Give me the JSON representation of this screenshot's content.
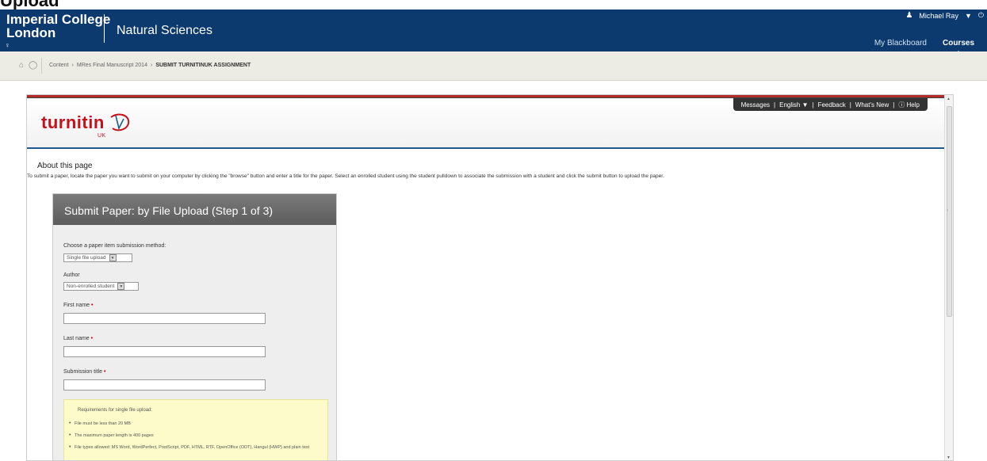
{
  "caption": "Upload",
  "header": {
    "logo_line1": "Imperial College",
    "logo_line2": "London",
    "department": "Natural Sciences",
    "user_name": "Michael Ray",
    "nav": {
      "my_blackboard": "My Blackboard",
      "courses": "Courses"
    }
  },
  "breadcrumb": {
    "items": [
      "Content",
      "›",
      "MRes Final Manuscript 2014",
      "›"
    ],
    "current": "SUBMIT TURNITINUK ASSIGNMENT"
  },
  "turnitin": {
    "logo": "turnitin",
    "logo_sub": "UK",
    "utility": [
      "Messages",
      "|",
      "English ▼",
      "|",
      "Feedback",
      "|",
      "What's New",
      "|",
      "ⓘ Help"
    ]
  },
  "about": {
    "title": "About this page",
    "text": "To submit a paper, locate the paper you want to submit on your computer by clicking the \"browse\" button and enter a title for the paper. Select an enrolled student using the student pulldown to associate the submission with a student and click the submit button to upload the paper."
  },
  "form": {
    "title": "Submit Paper: by File Upload (Step 1 of 3)",
    "method_label": "Choose a paper item submission method:",
    "method_value": "Single file upload",
    "author_label": "Author",
    "author_value": "Non-enrolled student",
    "first_name_label": "First name",
    "last_name_label": "Last name",
    "submission_title_label": "Submission title",
    "required_mark": "•",
    "first_name_value": "",
    "last_name_value": "",
    "submission_title_value": ""
  },
  "requirements": {
    "title": "Requirements for single file upload:",
    "items": [
      "File must be less than 20 MB",
      "The maximum paper length is 400 pages",
      "File types allowed: MS Word, WordPerfect, PostScript, PDF, HTML, RTF, OpenOffice (ODT), Hangul (HWP) and plain text"
    ]
  }
}
